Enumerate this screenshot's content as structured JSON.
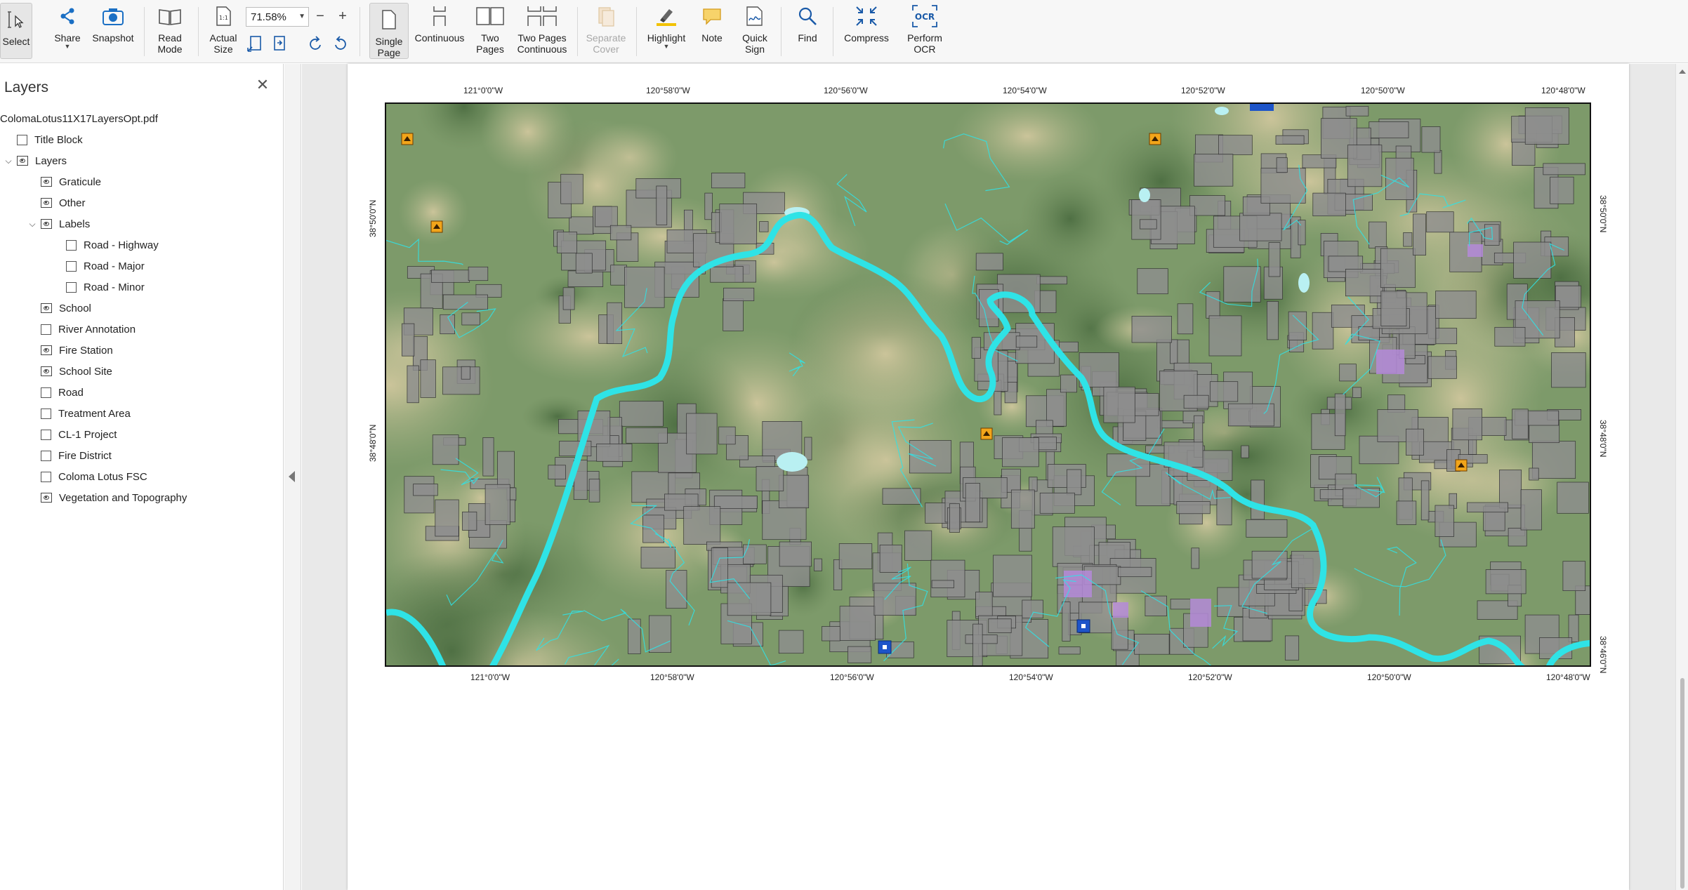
{
  "toolbar": {
    "select_label": "Select",
    "share_label": "Share",
    "snapshot_label": "Snapshot",
    "read_mode_label": "Read\nMode",
    "actual_size_label": "Actual\nSize",
    "zoom_value": "71.58%",
    "single_page_label": "Single\nPage",
    "continuous_label": "Continuous",
    "two_pages_label": "Two\nPages",
    "two_pages_continuous_label": "Two Pages\nContinuous",
    "separate_cover_label": "Separate\nCover",
    "highlight_label": "Highlight",
    "note_label": "Note",
    "quick_sign_label": "Quick\nSign",
    "find_label": "Find",
    "compress_label": "Compress",
    "perform_ocr_label": "Perform\nOCR",
    "ocr_icon_text": "OCR"
  },
  "layers_panel": {
    "title": "Layers",
    "items": [
      {
        "label": "ColomaLotus11X17LayersOpt.pdf",
        "kind": "file",
        "level": 0
      },
      {
        "label": "Title Block",
        "kind": "checkbox",
        "level": 1
      },
      {
        "label": "Layers",
        "kind": "eye",
        "level": 1,
        "expanded": true
      },
      {
        "label": "Graticule",
        "kind": "eye",
        "level": 2
      },
      {
        "label": "Other",
        "kind": "eye",
        "level": 2
      },
      {
        "label": "Labels",
        "kind": "eye",
        "level": 2,
        "expanded": true
      },
      {
        "label": "Road - Highway",
        "kind": "checkbox",
        "level": 3
      },
      {
        "label": "Road - Major",
        "kind": "checkbox",
        "level": 3
      },
      {
        "label": "Road - Minor",
        "kind": "checkbox",
        "level": 3
      },
      {
        "label": "School",
        "kind": "eye",
        "level": 2
      },
      {
        "label": "River Annotation",
        "kind": "checkbox",
        "level": 2
      },
      {
        "label": "Fire Station",
        "kind": "eye",
        "level": 2
      },
      {
        "label": "School Site",
        "kind": "eye",
        "level": 2
      },
      {
        "label": "Road",
        "kind": "checkbox",
        "level": 2
      },
      {
        "label": "Treatment Area",
        "kind": "checkbox",
        "level": 2
      },
      {
        "label": "CL-1 Project",
        "kind": "checkbox",
        "level": 2
      },
      {
        "label": "Fire District",
        "kind": "checkbox",
        "level": 2
      },
      {
        "label": "Coloma Lotus FSC",
        "kind": "checkbox",
        "level": 2
      },
      {
        "label": "Vegetation and Topography",
        "kind": "eye",
        "level": 2
      }
    ]
  },
  "map": {
    "top_longitudes": [
      "121°0'0\"W",
      "120°58'0\"W",
      "120°56'0\"W",
      "120°54'0\"W",
      "120°52'0\"W",
      "120°50'0\"W",
      "120°48'0\"W"
    ],
    "bottom_longitudes": [
      "121°0'0\"W",
      "120°58'0\"W",
      "120°56'0\"W",
      "120°54'0\"W",
      "120°52'0\"W",
      "120°50'0\"W",
      "120°48'0\"W"
    ],
    "left_latitudes": [
      "38°50'0\"N",
      "38°48'0\"N"
    ],
    "right_latitudes": [
      "38°50'0\"N",
      "38°48'0\"N",
      "38°46'0\"N"
    ],
    "colors": {
      "terrain": "#7f9a6b",
      "parcel": "#8d8d8d",
      "river": "#2fe3e6",
      "treatment": "#b48ad8"
    }
  }
}
